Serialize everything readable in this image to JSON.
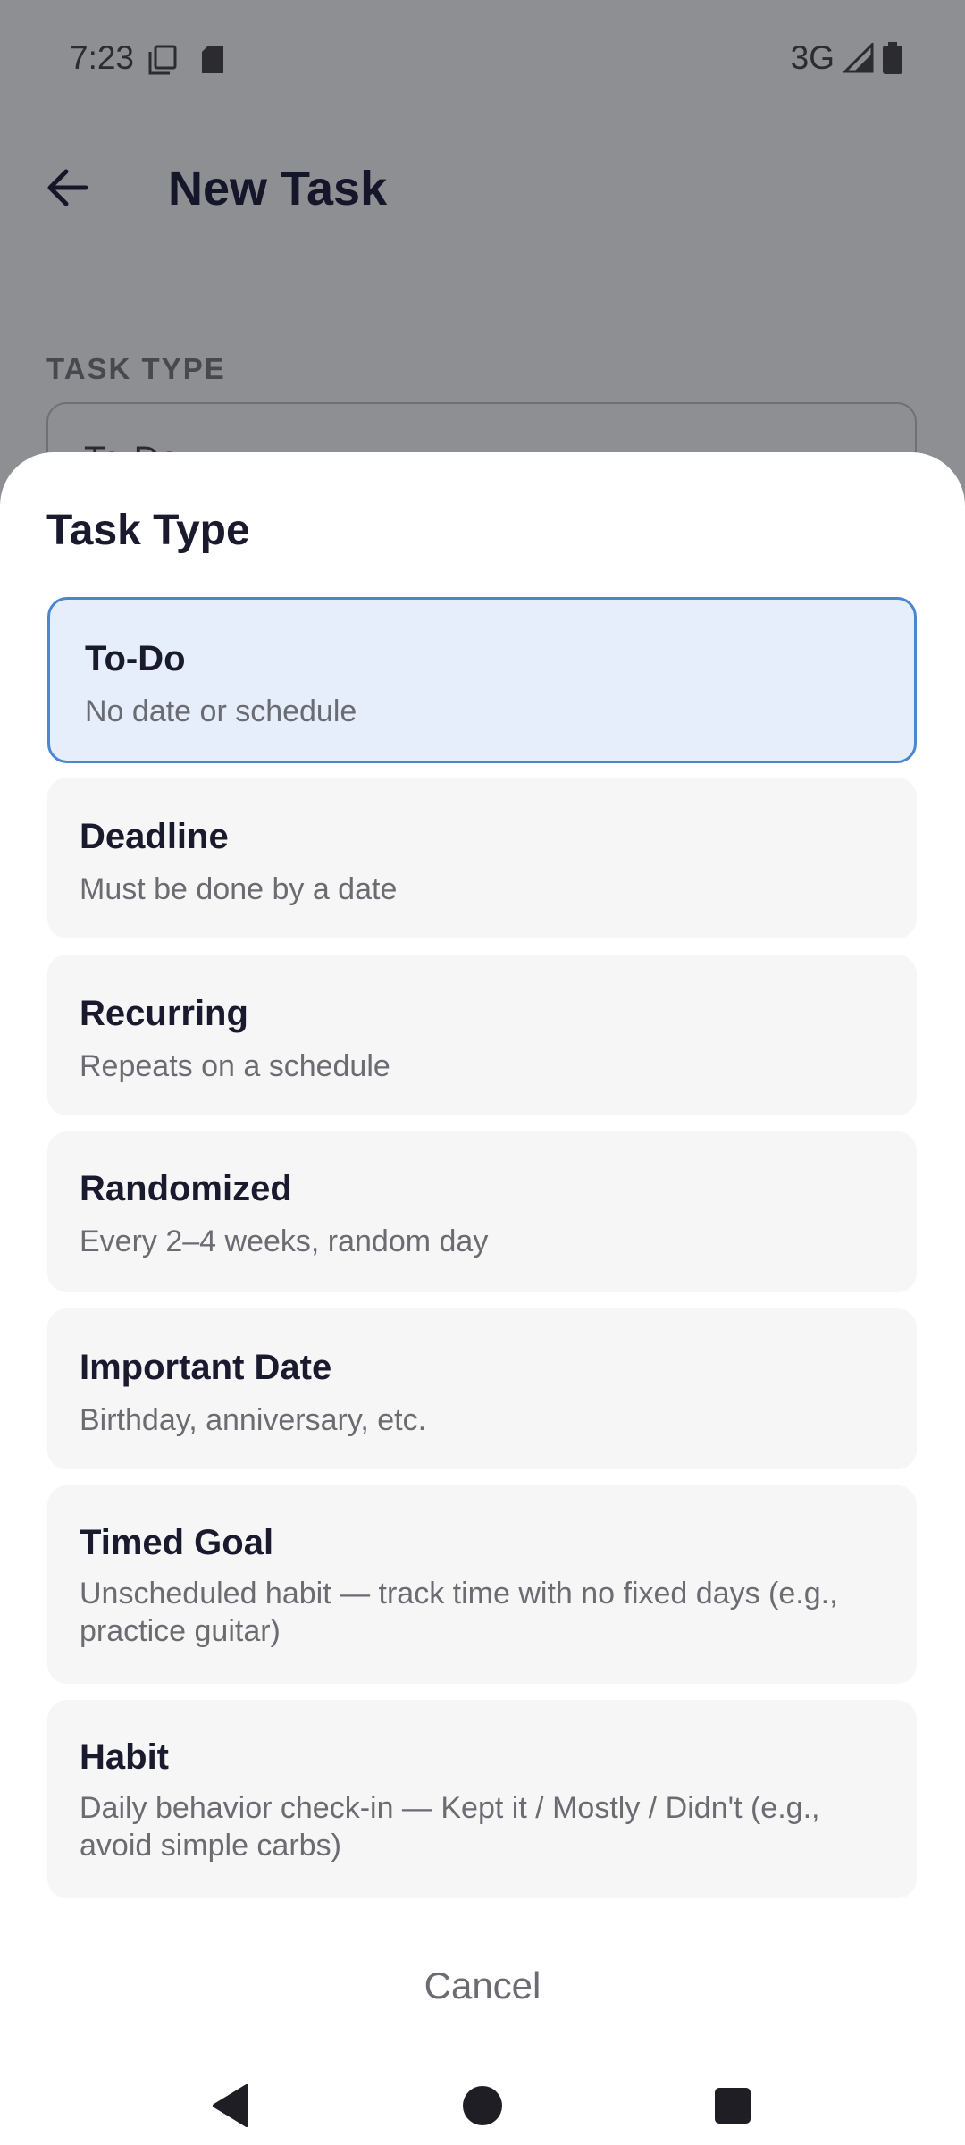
{
  "status_bar": {
    "time": "7:23",
    "network": "3G"
  },
  "app_bar": {
    "title": "New Task"
  },
  "background_form": {
    "section_label": "TASK TYPE",
    "field_value": "To-Do"
  },
  "sheet": {
    "title": "Task Type",
    "options": [
      {
        "title": "To-Do",
        "subtitle": "No date or schedule",
        "selected": true
      },
      {
        "title": "Deadline",
        "subtitle": "Must be done by a date",
        "selected": false
      },
      {
        "title": "Recurring",
        "subtitle": "Repeats on a schedule",
        "selected": false
      },
      {
        "title": "Randomized",
        "subtitle": "Every 2–4 weeks, random day",
        "selected": false
      },
      {
        "title": "Important Date",
        "subtitle": "Birthday, anniversary, etc.",
        "selected": false
      },
      {
        "title": "Timed Goal",
        "subtitle": "Unscheduled habit — track time with no fixed days (e.g., practice guitar)",
        "selected": false
      },
      {
        "title": "Habit",
        "subtitle": "Daily behavior check-in — Kept it / Mostly / Didn't (e.g., avoid simple carbs)",
        "selected": false
      }
    ],
    "cancel_label": "Cancel"
  },
  "colors": {
    "accent": "#4a86d2",
    "selected_bg": "#e6eefb",
    "option_bg": "#f6f6f7",
    "scrim": "#8e8f93"
  }
}
